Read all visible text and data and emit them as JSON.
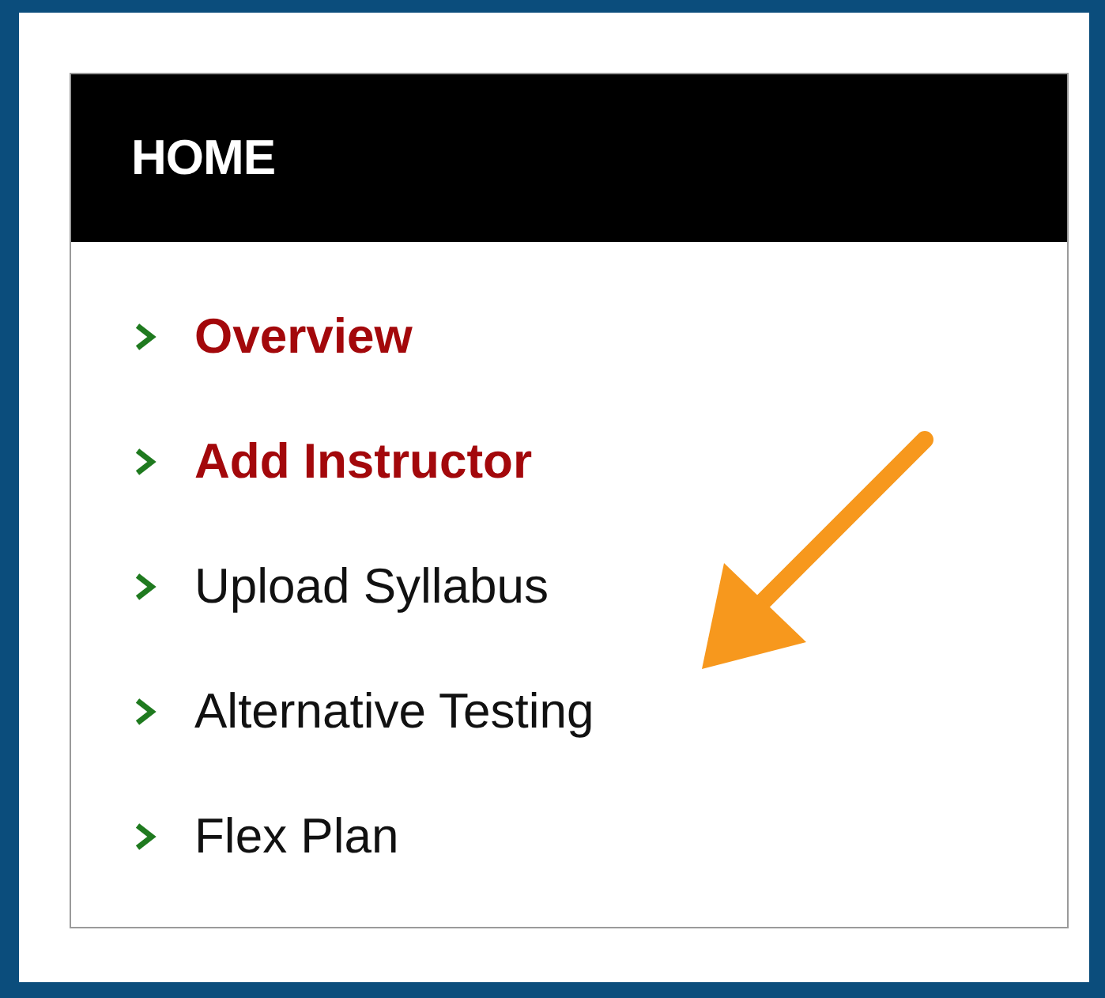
{
  "menu": {
    "title": "HOME",
    "items": [
      {
        "label": "Overview",
        "selected": true
      },
      {
        "label": "Add Instructor",
        "selected": true
      },
      {
        "label": "Upload Syllabus",
        "selected": false
      },
      {
        "label": "Alternative Testing",
        "selected": false
      },
      {
        "label": "Flex Plan",
        "selected": false
      }
    ]
  }
}
